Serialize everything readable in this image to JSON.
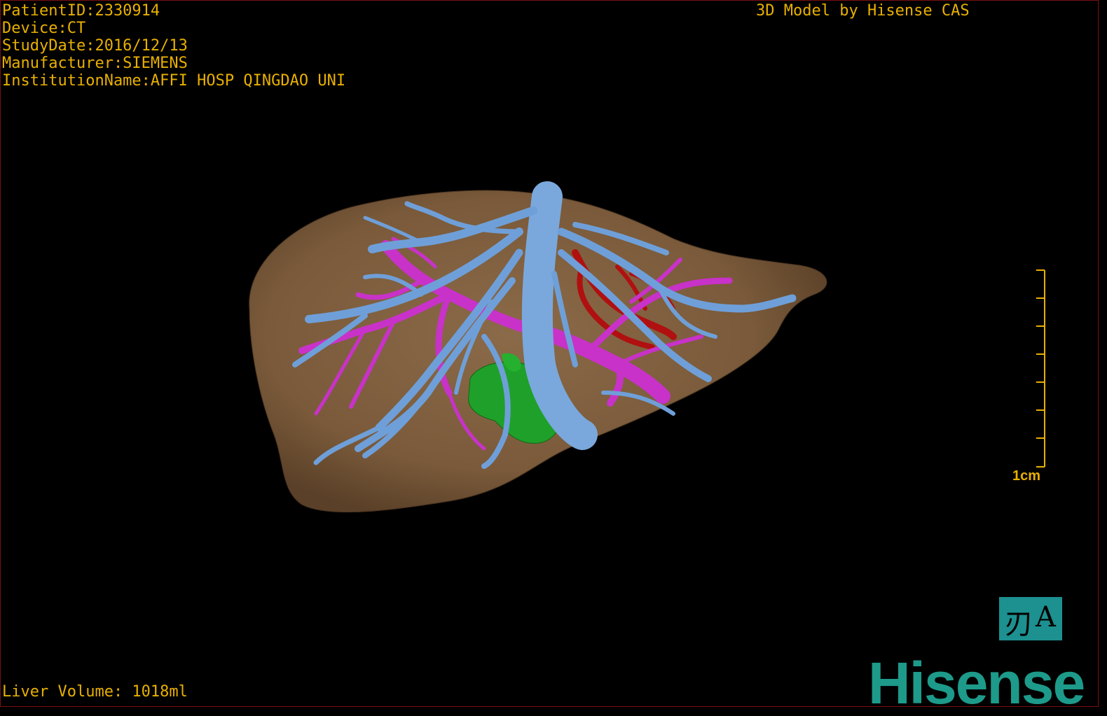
{
  "overlay": {
    "patient_id": "PatientID:2330914",
    "device": "Device:CT",
    "study_date": "StudyDate:2016/12/13",
    "manufacturer": "Manufacturer:SIEMENS",
    "institution": "InstitutionName:AFFI HOSP QINGDAO UNI",
    "credit": "3D Model by Hisense CAS",
    "liver_volume": "Liver Volume: 1018ml"
  },
  "scale_bar": {
    "label": "1cm"
  },
  "orientation": {
    "glyph_left": "刃",
    "glyph_right": "A"
  },
  "brand": {
    "logo_text": "Hisense"
  },
  "colors": {
    "overlay_text": "#e8b000",
    "liver": "#7a5a3a",
    "hepatic_vein": "#6f9fd8",
    "portal_vein": "#c832c8",
    "artery": "#b01010",
    "tumor": "#1fa02a",
    "brand": "#1d9a8a",
    "border": "#7a1010"
  }
}
